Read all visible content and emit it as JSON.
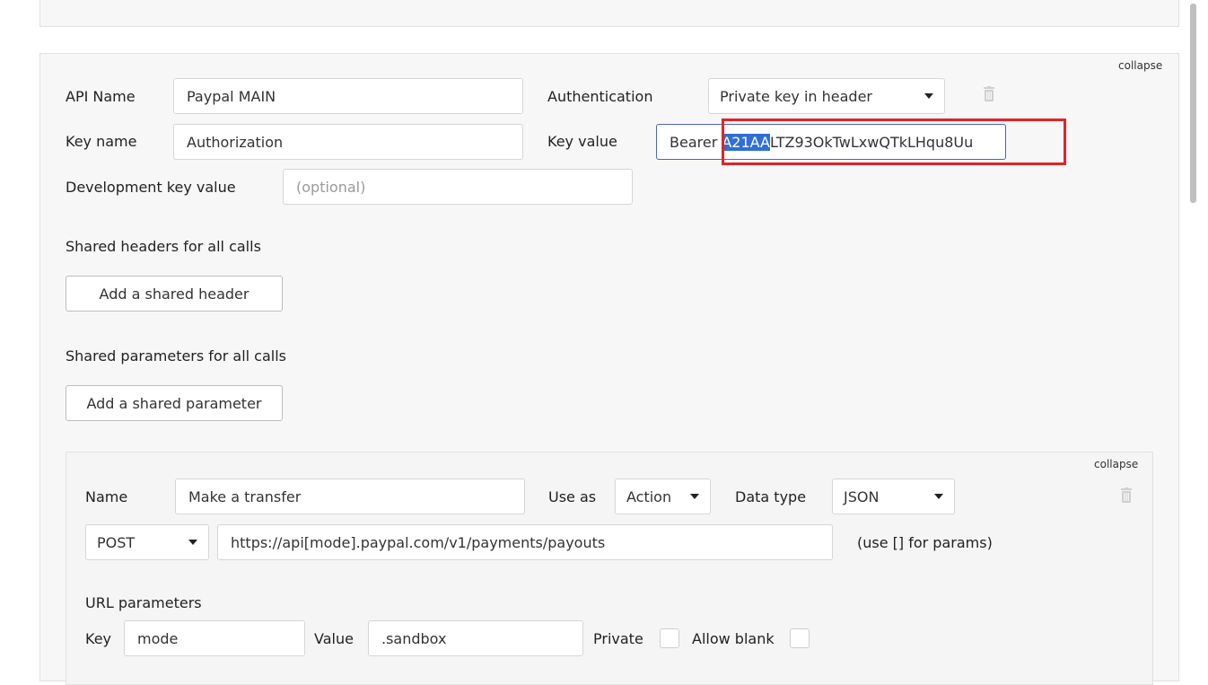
{
  "colors": {
    "highlight": "#2f6fd6",
    "annotation_box": "#e32226",
    "focus_border": "#4a63c9"
  },
  "api": {
    "collapse_label": "collapse",
    "api_name_label": "API Name",
    "api_name_value": "Paypal MAIN",
    "authentication_label": "Authentication",
    "authentication_value": "Private key in header",
    "key_name_label": "Key name",
    "key_name_value": "Authorization",
    "key_value_label": "Key value",
    "key_value_prefix": "Bearer ",
    "key_value_selected": "A21AA",
    "key_value_rest": "LTZ93OkTwLxwQTkLHqu8Uu",
    "dev_key_label": "Development key value",
    "dev_key_placeholder": "(optional)",
    "shared_headers_label": "Shared headers for all calls",
    "add_shared_header": "Add a shared header",
    "shared_params_label": "Shared parameters for all calls",
    "add_shared_param": "Add a shared parameter",
    "icons": {
      "delete": "trash-icon",
      "dropdown": "caret-down-icon"
    }
  },
  "call": {
    "collapse_label": "collapse",
    "name_label": "Name",
    "name_value": "Make a transfer",
    "use_as_label": "Use as",
    "use_as_value": "Action",
    "data_type_label": "Data type",
    "data_type_value": "JSON",
    "method_value": "POST",
    "url_value": "https://api[mode].paypal.com/v1/payments/payouts",
    "url_hint": "(use [] for params)",
    "url_params_label": "URL parameters",
    "param_key_label": "Key",
    "param_key_value": "mode",
    "param_value_label": "Value",
    "param_value_value": ".sandbox",
    "private_label": "Private",
    "allow_blank_label": "Allow blank"
  }
}
